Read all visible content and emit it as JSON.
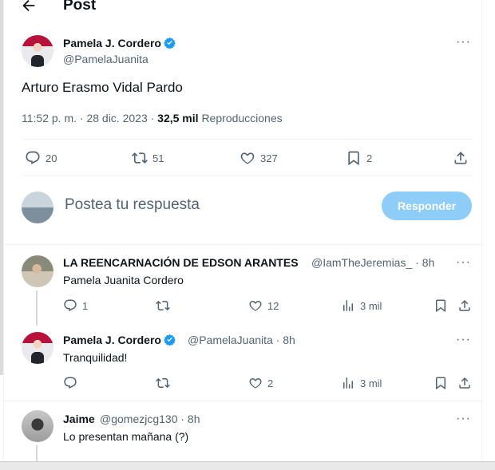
{
  "header": {
    "title": "Post"
  },
  "post": {
    "name": "Pamela J. Cordero",
    "handle": "@PamelaJuanita",
    "text": "Arturo Erasmo Vidal Pardo",
    "time": "11:52 p. m. · 28 dic. 2023 · ",
    "views_count": "32,5 mil",
    "views_label": "Reproducciones",
    "stats": {
      "replies": "20",
      "reposts": "51",
      "likes": "327",
      "bookmarks": "2"
    },
    "more_label": "···"
  },
  "compose": {
    "placeholder": "Postea tu respuesta",
    "button": "Responder"
  },
  "replies": [
    {
      "name": "LA REENCARNACIÓN DE EDSON ARANTES",
      "handle": "@IamTheJeremias_ · 8h",
      "text": "Pamela Juanita Cordero",
      "replies": "1",
      "reposts": "",
      "likes": "12",
      "views": "3 mil"
    },
    {
      "name": "Pamela J. Cordero",
      "handle": "@PamelaJuanita · 8h",
      "text": "Tranquilidad!",
      "replies": "",
      "reposts": "",
      "likes": "2",
      "views": "3 mil"
    },
    {
      "name": "Jaime",
      "handle": "@gomezjcg130 · 8h",
      "text": "Lo presentan mañana (?)"
    }
  ],
  "colors": {
    "accent": "#1d9bf0",
    "button_disabled": "#8ecdf8",
    "muted": "#536471"
  }
}
